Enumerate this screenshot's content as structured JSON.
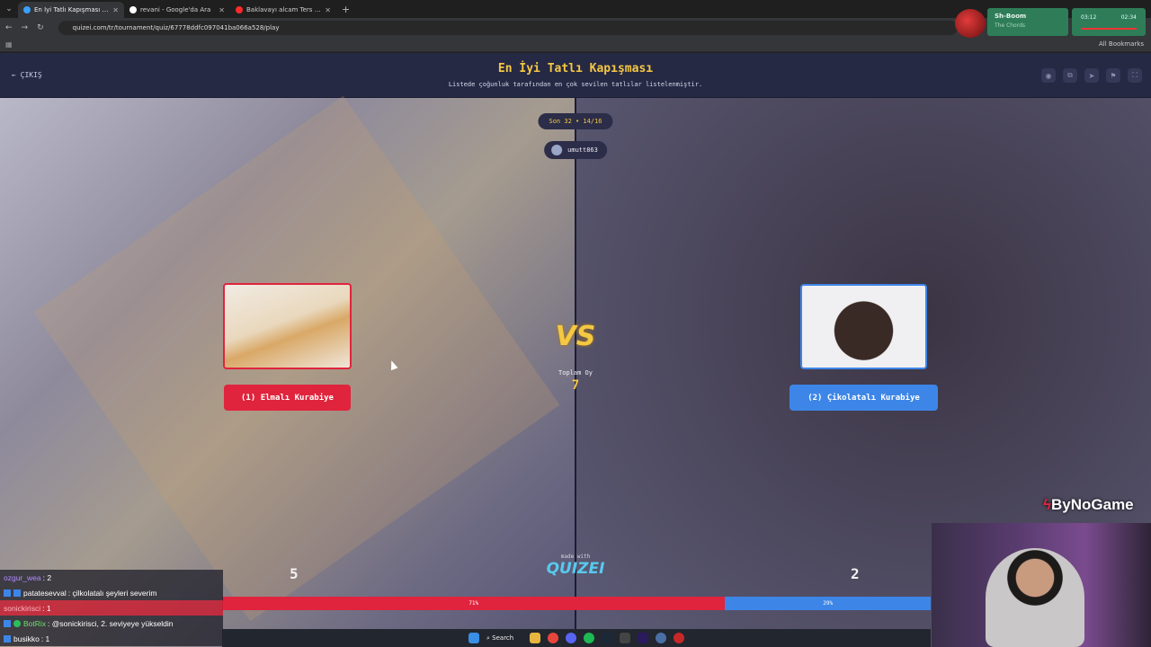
{
  "browser": {
    "tabs": [
      {
        "title": "En İyi Tatlı Kapışması - Tier List",
        "color": "#3aa0ff",
        "active": true
      },
      {
        "title": "revani - Google'da Ara",
        "color": "#ffffff",
        "active": false
      },
      {
        "title": "Baklavayı alcam Ters Çevircem Hi",
        "color": "#ff2a2a",
        "active": false
      }
    ],
    "new_tab_label": "+",
    "url": "quizei.com/tr/tournament/quiz/67778ddfc097041ba066a528/play",
    "all_bookmarks": "All Bookmarks"
  },
  "media": {
    "track_title": "Sh-Boom",
    "track_artist": "The Chords",
    "time_elapsed": "03:12",
    "time_total": "02:34"
  },
  "header": {
    "exit_label": "ÇIKIŞ",
    "title": "En İyi Tatlı Kapışması",
    "subtitle": "Listede çoğunluk tarafından en çok sevilen tatlılar listelenmiştir."
  },
  "round": {
    "label": "Son 32 • 14/16",
    "user": "umutt863"
  },
  "left": {
    "name": "(1) Elmalı Kurabiye",
    "votes": "5",
    "percent": "71%",
    "share": 0.71,
    "color": "#e0243d"
  },
  "right": {
    "name": "(2) Çikolatalı Kurabiye",
    "votes": "2",
    "percent": "29%",
    "share": 0.29,
    "color": "#3d86e8"
  },
  "center": {
    "vs": "VS",
    "total_label": "Toplam Oy",
    "total_value": "7",
    "made_with": "made with",
    "logo": "QUIZEI"
  },
  "chat": [
    {
      "user": "ozgur_wea",
      "text": ": 2",
      "highlight": false
    },
    {
      "user": "patatesevval",
      "text": ": çilkolatalı şeyleri severim",
      "highlight": false
    },
    {
      "user": "sonickirisci",
      "text": ": 1",
      "highlight": true
    },
    {
      "user": "BotRix",
      "text": ": @sonickirisci, 2. seviyeye yükseldin",
      "highlight": false
    },
    {
      "user": "busikko",
      "text": ": 1",
      "highlight": false
    }
  ],
  "branding": "ByNoGame",
  "taskbar": {
    "search_label": "Search"
  }
}
